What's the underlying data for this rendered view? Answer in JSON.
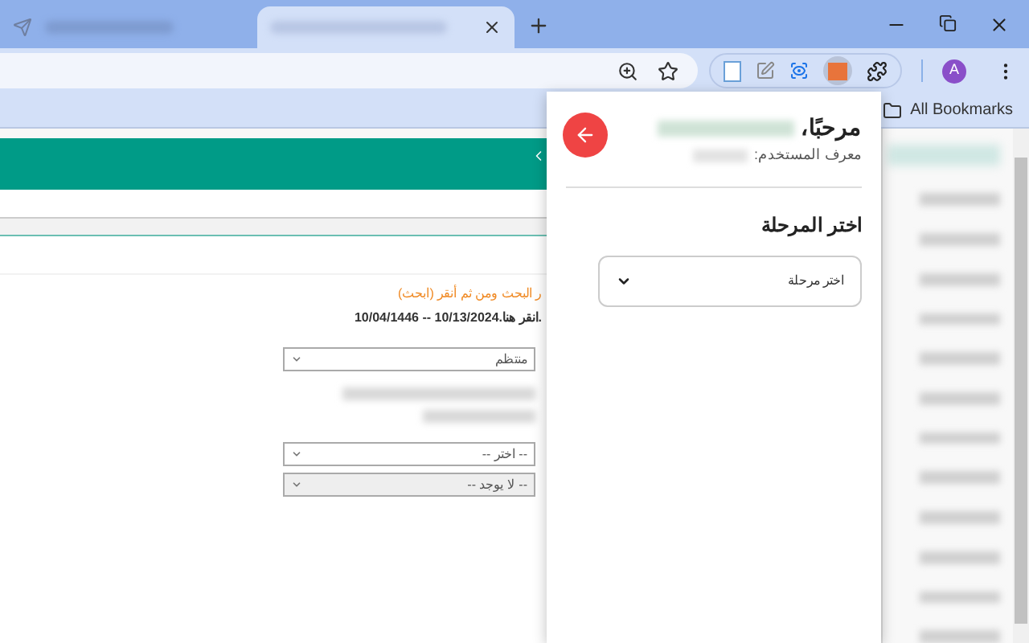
{
  "browser": {
    "tabs": [
      {
        "selected": false
      },
      {
        "selected": true
      }
    ],
    "profile_initial": "A",
    "bookmarks_label": "All Bookmarks"
  },
  "page": {
    "notice": "ر البحث ومن ثم أنقر (ابحث)",
    "date_line": "10/04/1446 -- 10/13/2024.انقر هنا.",
    "selects": [
      {
        "value": "منتظم",
        "disabled": false
      },
      {
        "value": "-- اختر --",
        "disabled": false
      },
      {
        "value": "-- لا يوجد --",
        "disabled": true
      }
    ]
  },
  "popup": {
    "greeting": "مرحبًا،",
    "user_id_label": "معرف المستخدم:",
    "section_title": "اختر المرحلة",
    "stage_select": {
      "placeholder": "اختر مرحلة"
    }
  }
}
